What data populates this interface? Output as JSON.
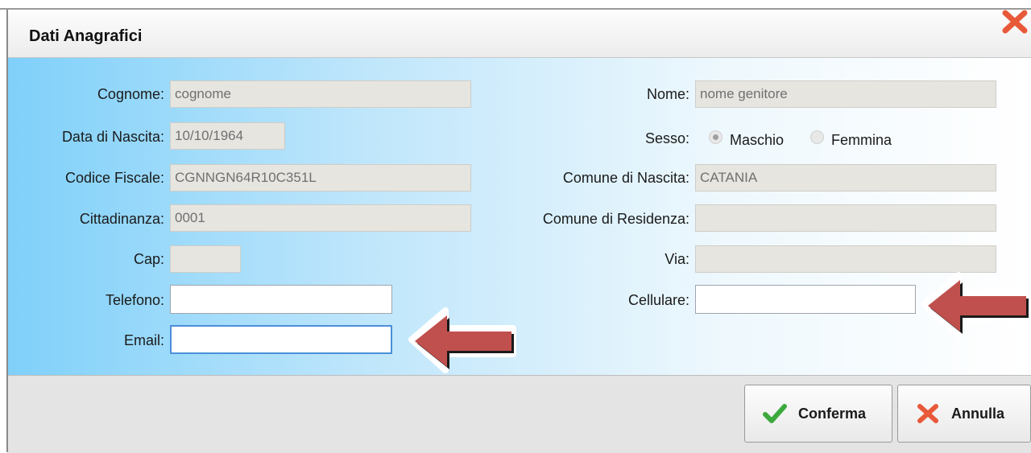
{
  "dialog": {
    "title": "Dati Anagrafici",
    "close_icon": "close-icon"
  },
  "form": {
    "cognome": {
      "label": "Cognome:",
      "value": "cognome"
    },
    "nome": {
      "label": "Nome:",
      "value": "nome genitore"
    },
    "data_nascita": {
      "label": "Data di Nascita:",
      "value": "10/10/1964"
    },
    "sesso": {
      "label": "Sesso:",
      "options": [
        "Maschio",
        "Femmina"
      ],
      "selected": "Maschio"
    },
    "codice_fiscale": {
      "label": "Codice Fiscale:",
      "value": "CGNNGN64R10C351L"
    },
    "comune_nascita": {
      "label": "Comune di Nascita:",
      "value": "CATANIA"
    },
    "cittadinanza": {
      "label": "Cittadinanza:",
      "value": "0001"
    },
    "comune_residenza": {
      "label": "Comune di Residenza:",
      "value": ""
    },
    "cap": {
      "label": "Cap:",
      "value": ""
    },
    "via": {
      "label": "Via:",
      "value": ""
    },
    "telefono": {
      "label": "Telefono:",
      "value": ""
    },
    "cellulare": {
      "label": "Cellulare:",
      "value": ""
    },
    "email": {
      "label": "Email:",
      "value": ""
    }
  },
  "footer": {
    "confirm_label": "Conferma",
    "cancel_label": "Annulla"
  },
  "colors": {
    "panel_gradient_start": "#7fd0fa",
    "arrow_fill": "#c0504d",
    "confirm_check": "#3ca93c",
    "cancel_x": "#e8593a"
  }
}
